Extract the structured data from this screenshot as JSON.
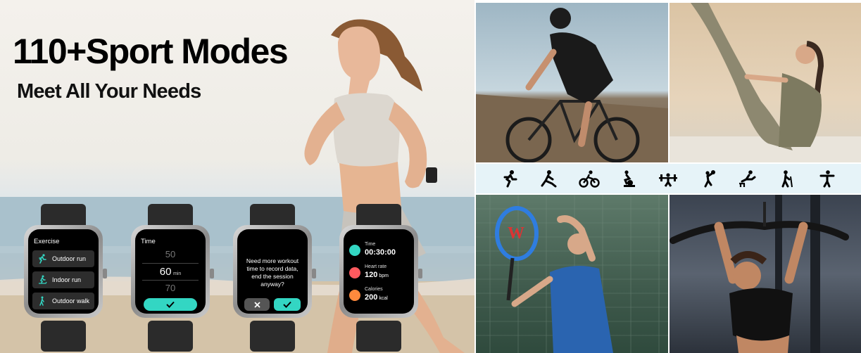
{
  "banner": {
    "title": "110+Sport Modes",
    "subtitle": "Meet All Your Needs"
  },
  "watch1": {
    "screen_title": "Exercise",
    "items": [
      {
        "label": "Outdoor run",
        "icon": "running-icon"
      },
      {
        "label": "Indoor run",
        "icon": "treadmill-icon"
      },
      {
        "label": "Outdoor walk",
        "icon": "walking-icon"
      }
    ]
  },
  "watch2": {
    "screen_title": "Time",
    "value_above": "50",
    "value_selected": "60",
    "unit": "min",
    "value_below": "70",
    "confirm_icon": "checkmark-icon"
  },
  "watch3": {
    "question": "Need more workout time to record data, end the session anyway?",
    "cancel_icon": "close-icon",
    "confirm_icon": "checkmark-icon"
  },
  "watch4": {
    "time_label": "Time",
    "time_value": "00:30:00",
    "hr_label": "Heart rate",
    "hr_value": "120",
    "hr_unit": "bpm",
    "cal_label": "Calories",
    "cal_value": "200",
    "cal_unit": "kcal"
  },
  "sport_icons": [
    "running-icon",
    "stretching-icon",
    "cycling-icon",
    "indoor-bike-icon",
    "weightlifting-icon",
    "volleyball-icon",
    "hurdles-icon",
    "hiking-icon",
    "dance-icon"
  ],
  "colors": {
    "accent": "#33d6c3",
    "strip_bg": "#e6f3f8"
  }
}
